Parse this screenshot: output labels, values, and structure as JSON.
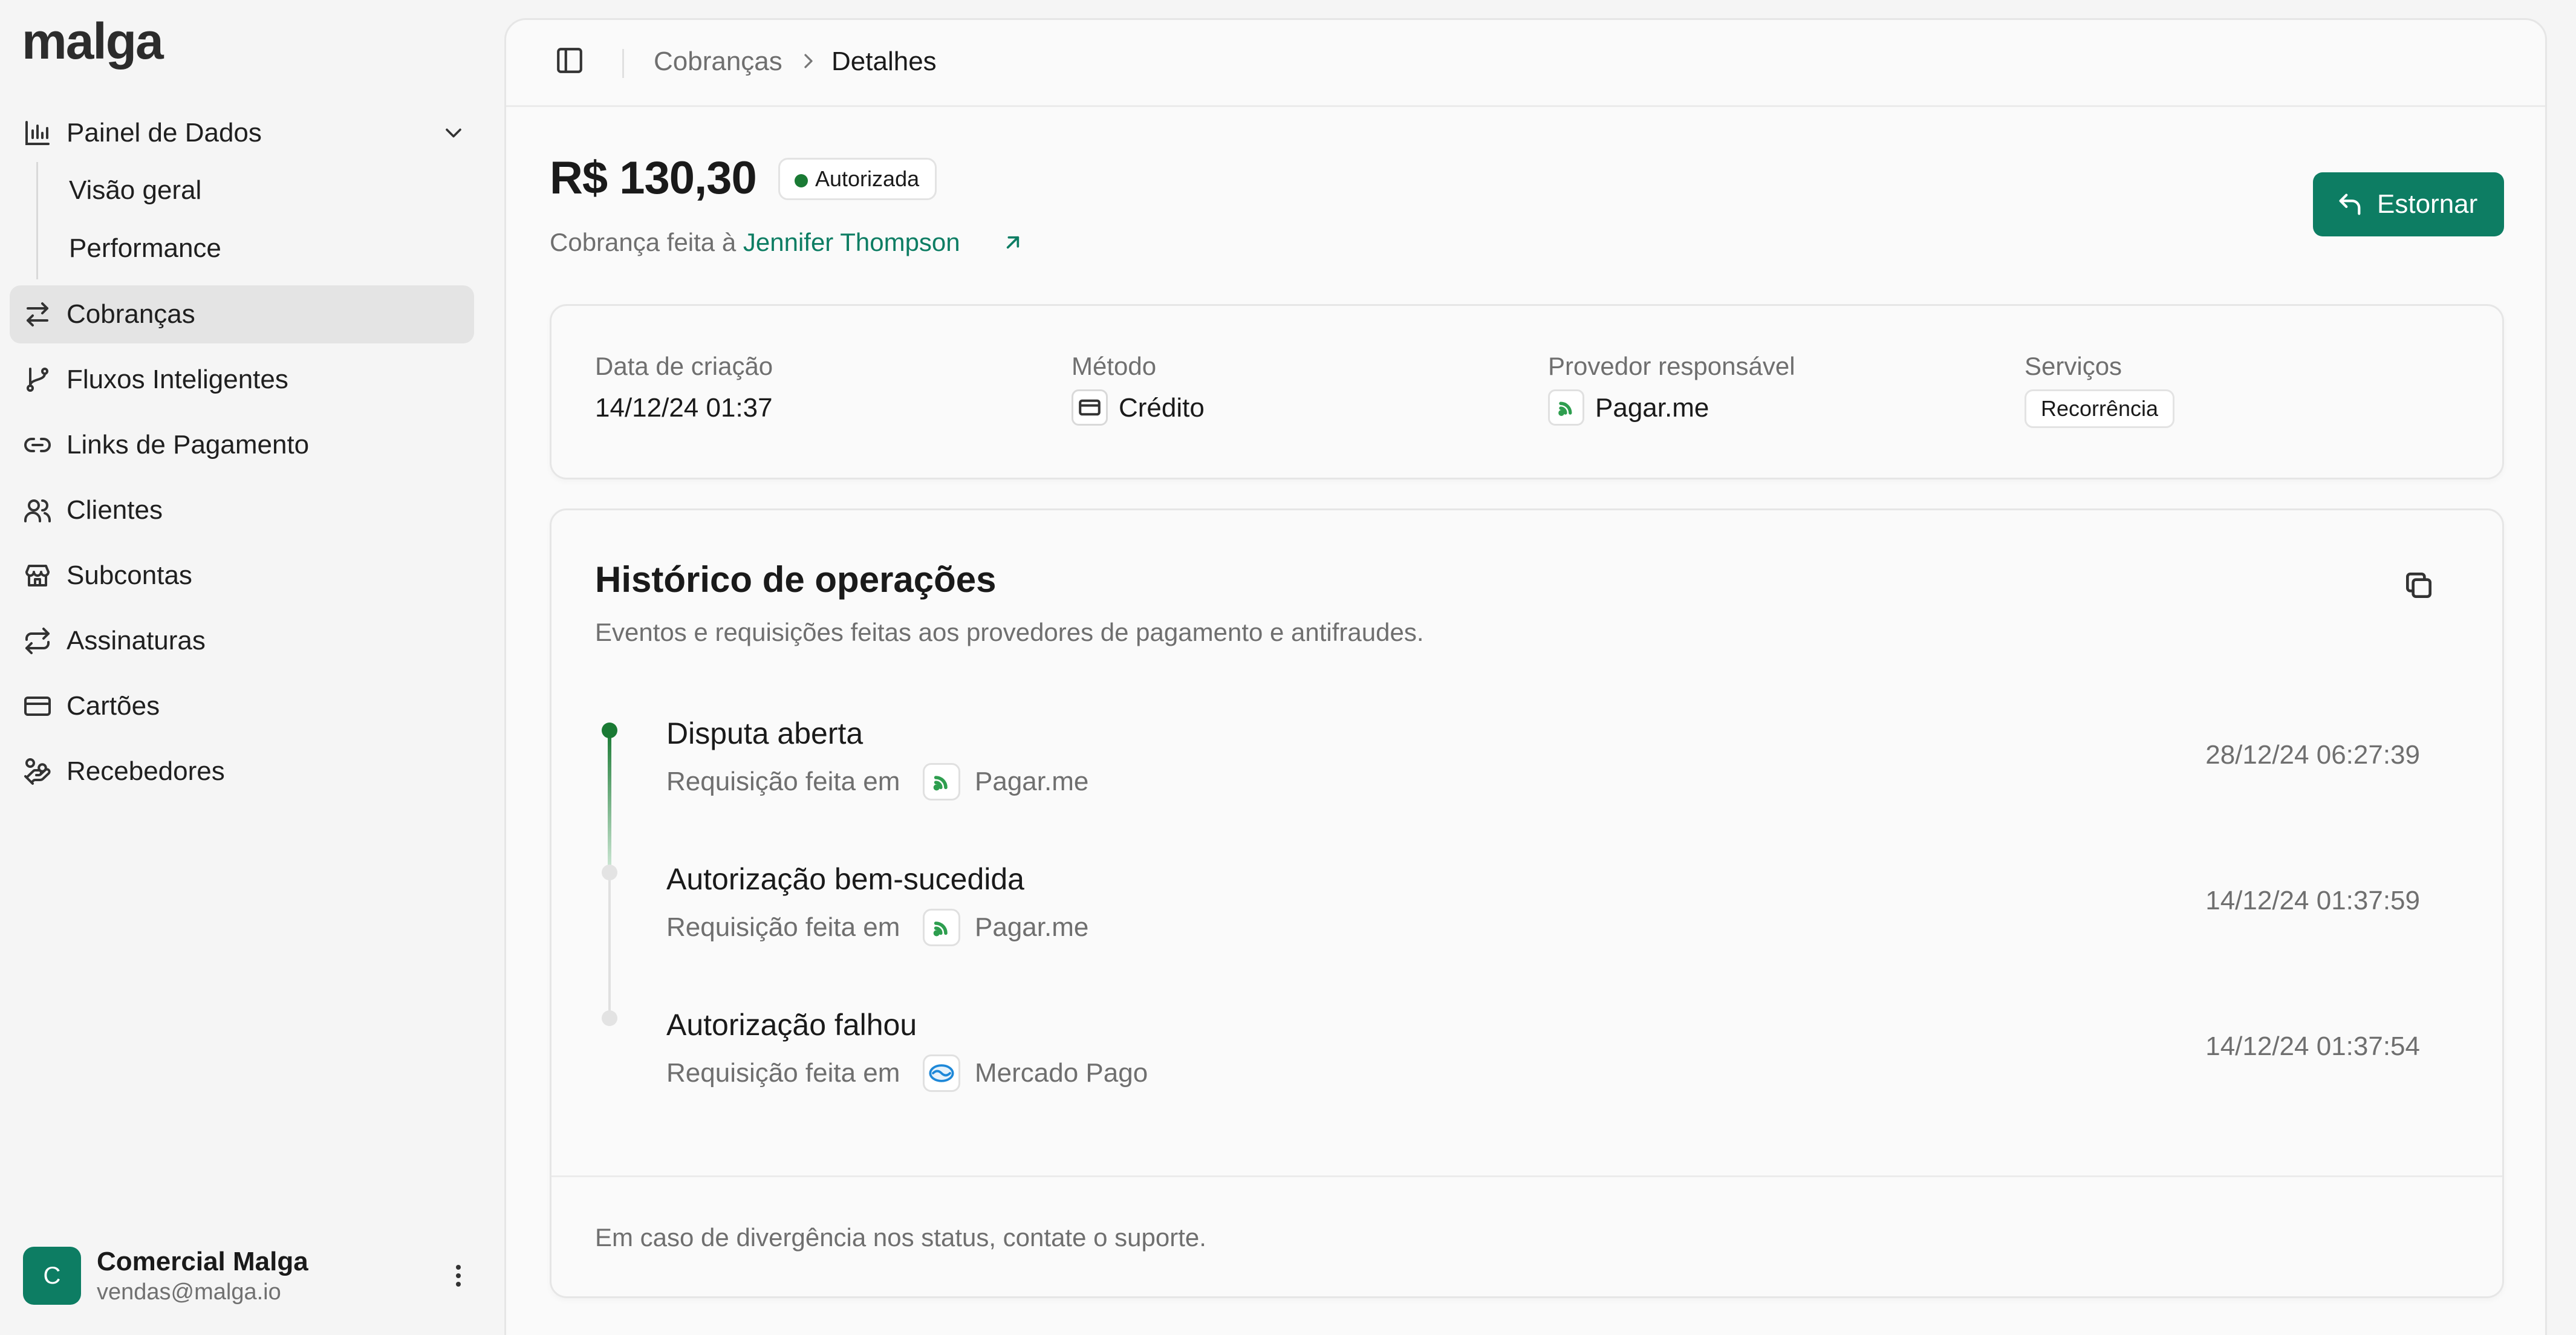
{
  "app": {
    "logo": "malga"
  },
  "sidebar": {
    "items": [
      {
        "label": "Painel de Dados",
        "icon": "bar-chart-icon"
      },
      {
        "label": "Cobranças",
        "icon": "arrows-exchange-icon"
      },
      {
        "label": "Fluxos Inteligentes",
        "icon": "git-branch-icon"
      },
      {
        "label": "Links de Pagamento",
        "icon": "link-icon"
      },
      {
        "label": "Clientes",
        "icon": "users-icon"
      },
      {
        "label": "Subcontas",
        "icon": "store-icon"
      },
      {
        "label": "Assinaturas",
        "icon": "repeat-icon"
      },
      {
        "label": "Cartões",
        "icon": "credit-card-icon"
      },
      {
        "label": "Recebedores",
        "icon": "hand-coins-icon"
      }
    ],
    "subitems": [
      {
        "label": "Visão geral"
      },
      {
        "label": "Performance"
      }
    ],
    "active_item": "Cobranças"
  },
  "account": {
    "initial": "C",
    "name": "Comercial Malga",
    "email": "vendas@malga.io"
  },
  "breadcrumb": {
    "parent": "Cobranças",
    "current": "Detalhes"
  },
  "charge": {
    "amount": "R$ 130,30",
    "status": "Autorizada",
    "charged_to_prefix": "Cobrança feita à",
    "customer": "Jennifer Thompson",
    "refund_label": "Estornar"
  },
  "details": {
    "created_label": "Data de criação",
    "created_value": "14/12/24 01:37",
    "method_label": "Método",
    "method_value": "Crédito",
    "provider_label": "Provedor responsável",
    "provider_value": "Pagar.me",
    "services_label": "Serviços",
    "services_value": "Recorrência"
  },
  "history": {
    "title": "Histórico de operações",
    "description": "Eventos e requisições feitas aos provedores de pagamento e antifraudes.",
    "request_prefix": "Requisição feita em",
    "events": [
      {
        "title": "Disputa aberta",
        "provider": "Pagar.me",
        "time": "28/12/24 06:27:39"
      },
      {
        "title": "Autorização bem-sucedida",
        "provider": "Pagar.me",
        "time": "14/12/24 01:37:59"
      },
      {
        "title": "Autorização falhou",
        "provider": "Mercado Pago",
        "time": "14/12/24 01:37:54"
      }
    ],
    "footer": "Em caso de divergência nos status, contate o suporte."
  },
  "colors": {
    "brand": "#0d7d63",
    "status_green": "#1a7a34"
  }
}
